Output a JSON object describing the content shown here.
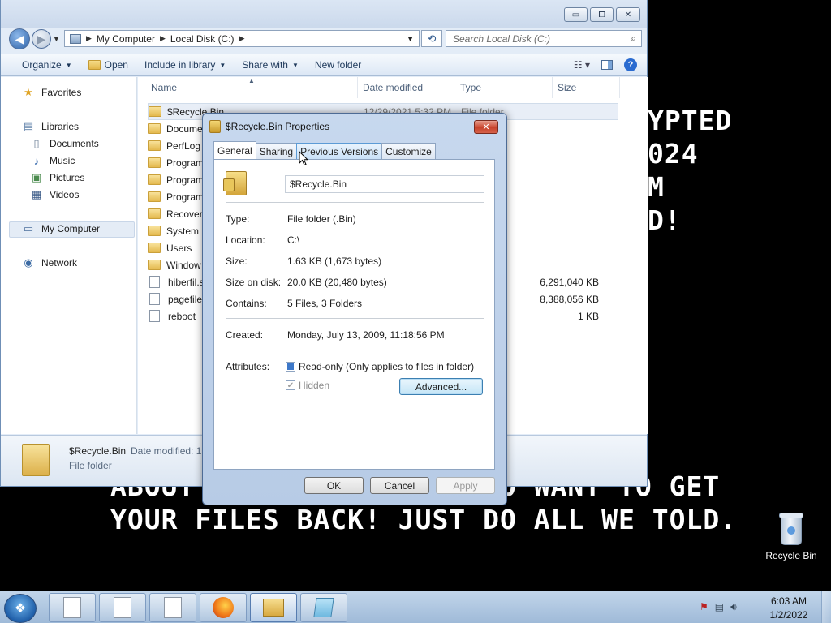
{
  "wallpaper": {
    "top_lines": "YPTED\n024\nM\nD!",
    "bottom_lines": "EONE\nABOUT                  O WANT TO GET\nYOUR FILES BACK! JUST DO ALL WE TOLD."
  },
  "desktop": {
    "recycle_bin_label": "Recycle Bin"
  },
  "explorer": {
    "caption": {
      "minimize": "▭",
      "maximize": "⧠",
      "close": "✕"
    },
    "breadcrumb": [
      "My Computer",
      "Local Disk (C:)"
    ],
    "search_placeholder": "Search Local Disk (C:)",
    "toolbar": {
      "organize": "Organize",
      "open": "Open",
      "include": "Include in library",
      "share": "Share with",
      "new_folder": "New folder"
    },
    "nav": {
      "favorites": "Favorites",
      "libraries": "Libraries",
      "documents": "Documents",
      "music": "Music",
      "pictures": "Pictures",
      "videos": "Videos",
      "computer": "My Computer",
      "network": "Network"
    },
    "columns": {
      "name": "Name",
      "date": "Date modified",
      "type": "Type",
      "size": "Size"
    },
    "rows": [
      {
        "name": "$Recycle.Bin",
        "date": "12/29/2021 5:32 PM",
        "type": "File folder",
        "size": "",
        "kind": "lock"
      },
      {
        "name": "Docume",
        "size": "",
        "kind": "folder"
      },
      {
        "name": "PerfLog",
        "size": "",
        "kind": "folder"
      },
      {
        "name": "Program",
        "size": "",
        "kind": "folder"
      },
      {
        "name": "Program",
        "size": "",
        "kind": "folder"
      },
      {
        "name": "Program",
        "size": "",
        "kind": "folder"
      },
      {
        "name": "Recover",
        "size": "",
        "kind": "folder"
      },
      {
        "name": "System",
        "size": "",
        "kind": "folder"
      },
      {
        "name": "Users",
        "size": "",
        "kind": "folder"
      },
      {
        "name": "Window",
        "size": "",
        "kind": "folder"
      },
      {
        "name": "hiberfil.s",
        "size": "6,291,040 KB",
        "kind": "file"
      },
      {
        "name": "pagefile",
        "size": "8,388,056 KB",
        "kind": "file"
      },
      {
        "name": "reboot",
        "size": "1 KB",
        "kind": "file"
      }
    ],
    "details": {
      "name": "$Recycle.Bin",
      "date_label": "Date modified:  1",
      "type": "File folder"
    }
  },
  "dialog": {
    "title": "$Recycle.Bin Properties",
    "tabs": [
      "General",
      "Sharing",
      "Previous Versions",
      "Customize"
    ],
    "name_value": "$Recycle.Bin",
    "fields": {
      "type_label": "Type:",
      "type_value": "File folder (.Bin)",
      "location_label": "Location:",
      "location_value": "C:\\",
      "size_label": "Size:",
      "size_value": "1.63 KB (1,673 bytes)",
      "disk_label": "Size on disk:",
      "disk_value": "20.0 KB (20,480 bytes)",
      "contains_label": "Contains:",
      "contains_value": "5 Files, 3 Folders",
      "created_label": "Created:",
      "created_value": "Monday, July 13, 2009, 11:18:56 PM",
      "attributes_label": "Attributes:"
    },
    "readonly_label": "Read-only (Only applies to files in folder)",
    "hidden_label": "Hidden",
    "advanced_button": "Advanced...",
    "ok_button": "OK",
    "cancel_button": "Cancel",
    "apply_button": "Apply"
  },
  "taskbar": {
    "time": "6:03 AM",
    "date": "1/2/2022"
  }
}
